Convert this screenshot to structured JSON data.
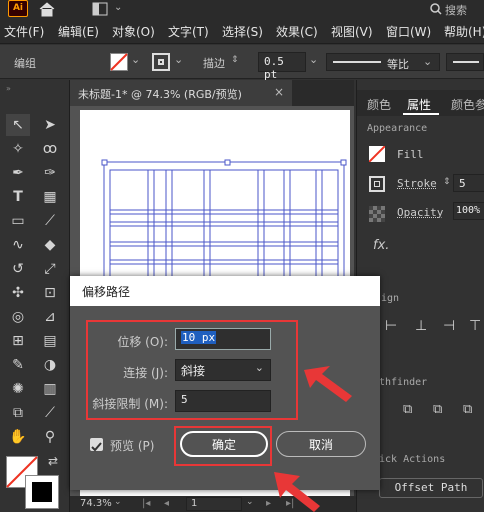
{
  "app": {
    "logo": "Ai",
    "search_label": "搜索"
  },
  "menu": {
    "items": [
      "文件(F)",
      "编辑(E)",
      "对象(O)",
      "文字(T)",
      "选择(S)",
      "效果(C)",
      "视图(V)",
      "窗口(W)",
      "帮助(H)"
    ]
  },
  "control_bar": {
    "group_label": "编组",
    "stroke_label": "描边",
    "stroke_weight": "0.5 pt",
    "profile_label": "等比"
  },
  "document": {
    "tab_title": "未标题-1* @ 74.3% (RGB/预览)",
    "close_glyph": "×"
  },
  "status": {
    "zoom": "74.3%",
    "page": "1"
  },
  "right_panel": {
    "tabs": [
      "颜色",
      "属性",
      "颜色参"
    ],
    "appearance_heading": "Appearance",
    "fill_label": "Fill",
    "stroke_label": "Stroke",
    "stroke_value": "5",
    "opacity_label": "Opacity",
    "opacity_value": "100%",
    "fx_label": "fx.",
    "align_heading": "ign",
    "pathfinder_heading": "thfinder",
    "quick_actions_heading": "ick Actions",
    "offset_path_button": "Offset Path"
  },
  "dialog": {
    "title": "偏移路径",
    "offset_label": "位移 (O):",
    "offset_value": "10 px",
    "joins_label": "连接 (J):",
    "joins_value": "斜接",
    "miter_label": "斜接限制 (M):",
    "miter_value": "5",
    "preview_label": "预览 (P)",
    "preview_checked": true,
    "ok_label": "确定",
    "cancel_label": "取消"
  },
  "colors": {
    "accent_red": "#e83737",
    "brand_orange": "#ff9a00"
  }
}
